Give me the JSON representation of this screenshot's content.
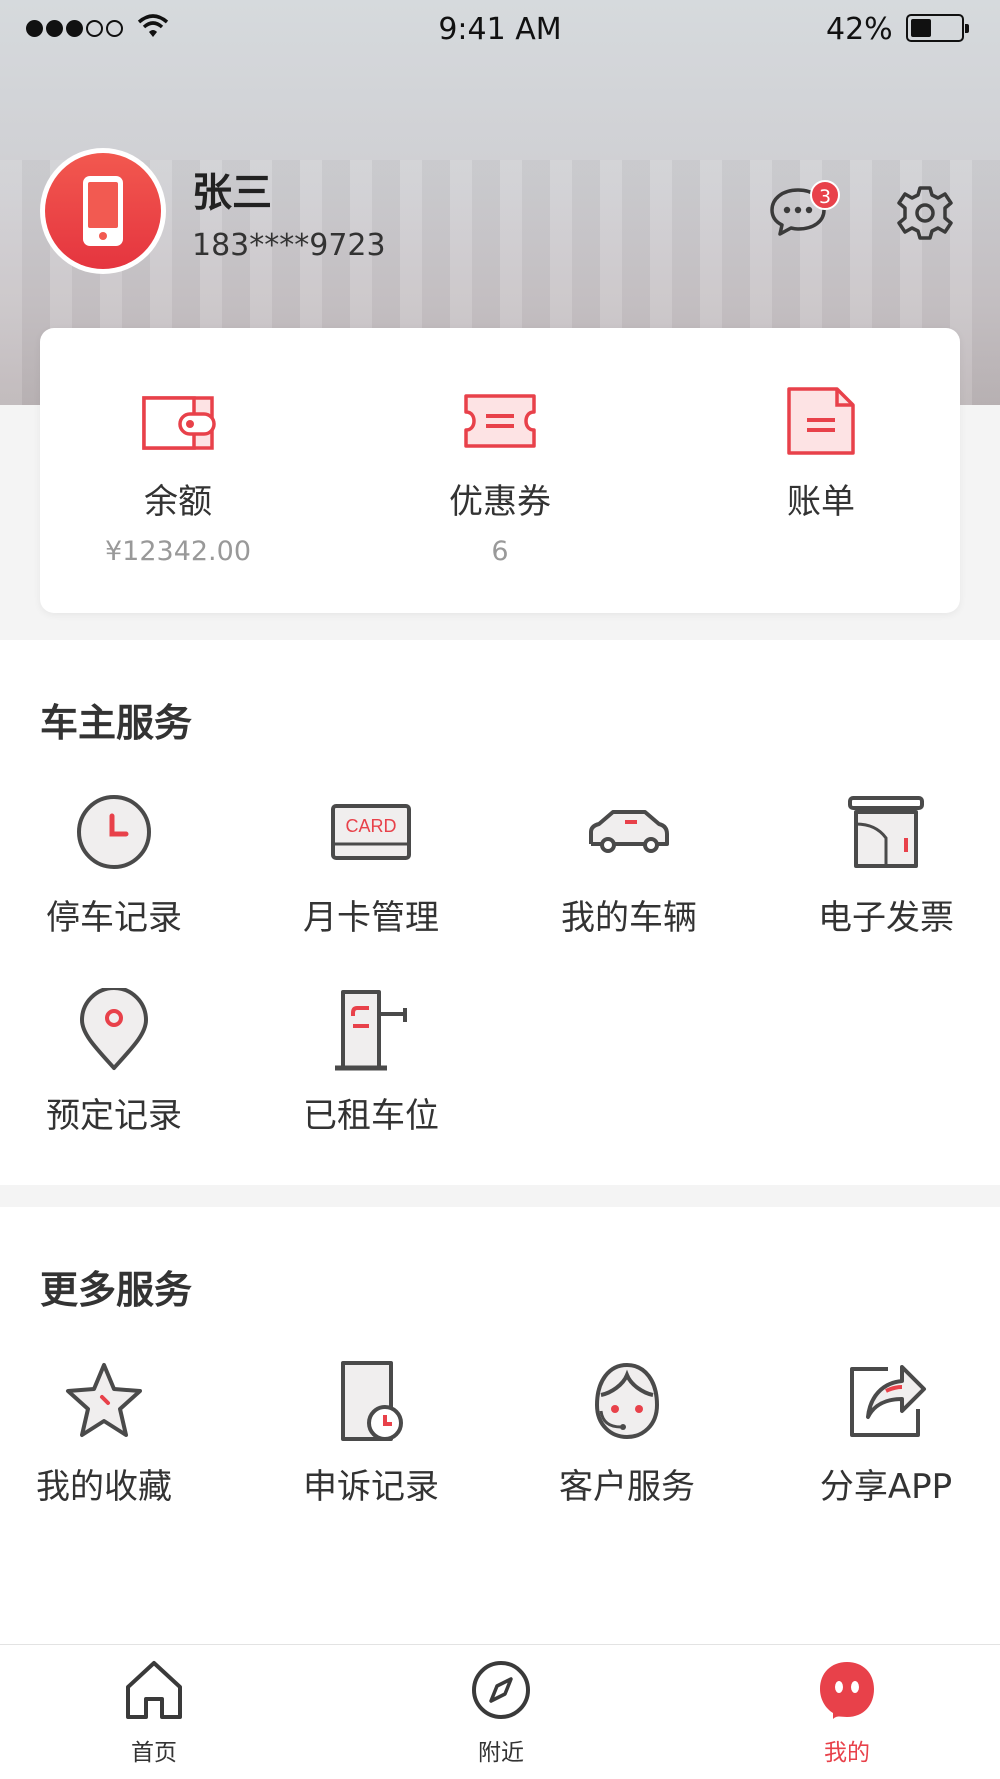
{
  "status_bar": {
    "time": "9:41 AM",
    "battery": "42%",
    "battery_level": 0.42
  },
  "profile": {
    "name": "张三",
    "phone": "183****9723",
    "message_count": "3"
  },
  "wallet": [
    {
      "label": "余额",
      "value": "¥12342.00",
      "icon": "wallet-icon"
    },
    {
      "label": "优惠券",
      "value": "6",
      "icon": "coupon-icon"
    },
    {
      "label": "账单",
      "value": "",
      "icon": "bill-icon"
    }
  ],
  "owner_services": {
    "title": "车主服务",
    "items": [
      {
        "label": "停车记录",
        "icon": "clock-icon"
      },
      {
        "label": "月卡管理",
        "icon": "card-icon",
        "icon_text": "CARD"
      },
      {
        "label": "我的车辆",
        "icon": "car-icon"
      },
      {
        "label": "电子发票",
        "icon": "invoice-icon"
      },
      {
        "label": "预定记录",
        "icon": "location-pin-icon"
      },
      {
        "label": "已租车位",
        "icon": "parking-gate-icon"
      }
    ]
  },
  "more_services": {
    "title": "更多服务",
    "items": [
      {
        "label": "我的收藏",
        "icon": "star-icon"
      },
      {
        "label": "申诉记录",
        "icon": "appeal-record-icon"
      },
      {
        "label": "客户服务",
        "icon": "customer-service-icon"
      },
      {
        "label": "分享APP",
        "icon": "share-icon"
      }
    ]
  },
  "tabbar": [
    {
      "label": "首页",
      "icon": "home-icon",
      "active": false
    },
    {
      "label": "附近",
      "icon": "compass-icon",
      "active": false
    },
    {
      "label": "我的",
      "icon": "profile-face-icon",
      "active": true
    }
  ],
  "colors": {
    "accent": "#e8414a",
    "icon_dark": "#4a4a4a",
    "icon_fill": "#f0eeee"
  }
}
